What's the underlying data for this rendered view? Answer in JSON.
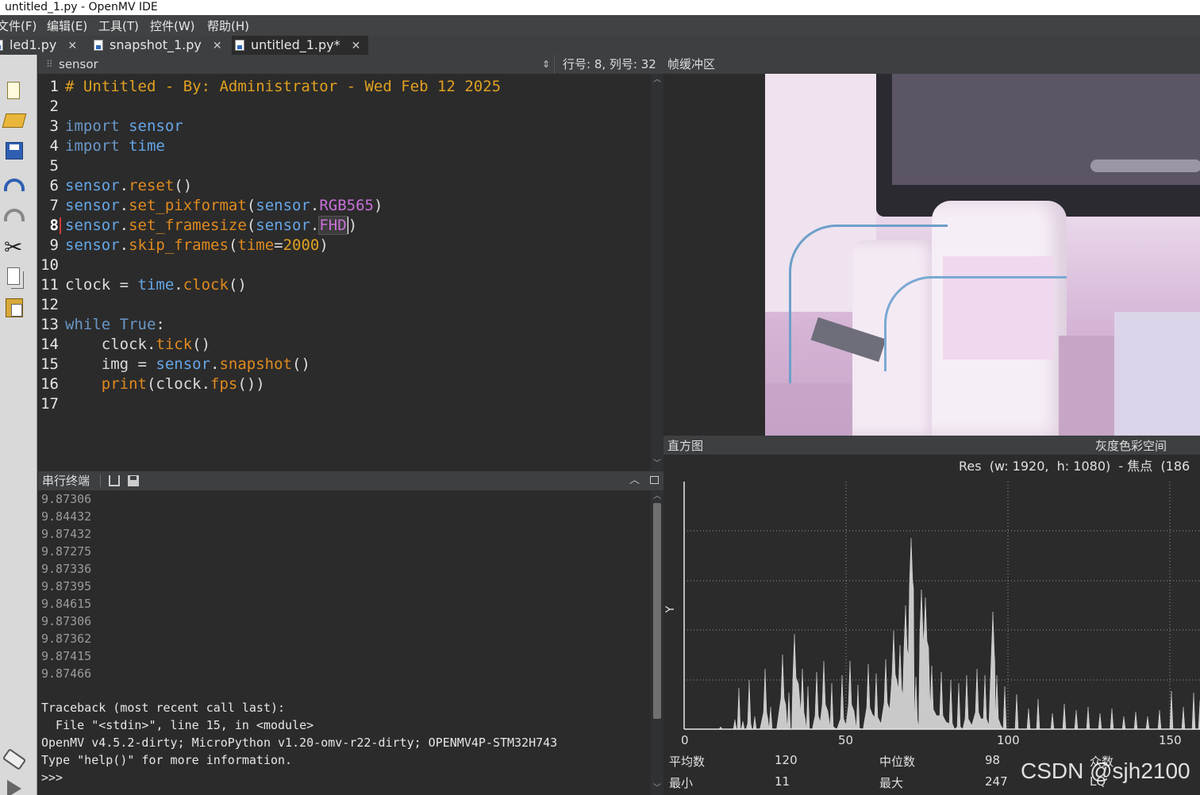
{
  "window": {
    "title": "untitled_1.py - OpenMV IDE"
  },
  "menu": [
    "文件(F)",
    "编辑(E)",
    "工具(T)",
    "控件(W)",
    "帮助(H)"
  ],
  "tabs": [
    {
      "label": "led1.py",
      "active": false
    },
    {
      "label": "snapshot_1.py",
      "active": false
    },
    {
      "label": "untitled_1.py*",
      "active": true
    }
  ],
  "editor": {
    "doc_selector": "sensor",
    "position": "行号: 8, 列号: 32",
    "line_numbers": [
      "1",
      "2",
      "3",
      "4",
      "5",
      "6",
      "7",
      "8",
      "9",
      "10",
      "11",
      "12",
      "13",
      "14",
      "15",
      "16",
      "17"
    ],
    "current_line": 8,
    "lines": [
      "# Untitled - By: Administrator - Wed Feb 12 2025",
      "",
      "import sensor",
      "import time",
      "",
      "sensor.reset()",
      "sensor.set_pixformat(sensor.RGB565)",
      "sensor.set_framesize(sensor.FHD)",
      "sensor.skip_frames(time=2000)",
      "",
      "clock = time.clock()",
      "",
      "while True:",
      "    clock.tick()",
      "    img = sensor.snapshot()",
      "    print(clock.fps())",
      ""
    ]
  },
  "terminal": {
    "title": "串行终端",
    "fps_lines": [
      "9.87306",
      "9.84432",
      "9.87432",
      "9.87275",
      "9.87336",
      "9.87395",
      "9.84615",
      "9.87306",
      "9.87362",
      "9.87415",
      "9.87466"
    ],
    "message_lines": [
      "Traceback (most recent call last):",
      "  File \"<stdin>\", line 15, in <module>",
      "OpenMV v4.5.2-dirty; MicroPython v1.20-omv-r22-dirty; OPENMV4P-STM32H743",
      "Type \"help()\" for more information.",
      ">>>"
    ]
  },
  "framebuffer": {
    "title": "帧缓冲区"
  },
  "histogram": {
    "title": "直方图",
    "color_space": "灰度色彩空间",
    "resolution_text": "Res  (w: 1920,  h: 1080)  - 焦点  (186",
    "y_axis_label": "Y",
    "x_ticks": [
      "0",
      "50",
      "100",
      "150"
    ],
    "stats": {
      "mean_label": "平均数",
      "mean": "120",
      "median_label": "中位数",
      "median": "98",
      "mode_label": "众数",
      "min_label": "最小",
      "min": "11",
      "max_label": "最大",
      "max": "247",
      "lq_label": "LQ"
    }
  },
  "watermark": "CSDN @sjh2100"
}
